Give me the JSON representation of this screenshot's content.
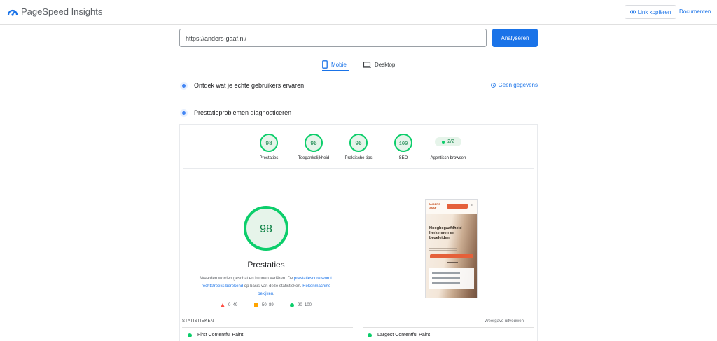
{
  "header": {
    "brand": "PageSpeed Insights",
    "copy_link_label": "Link kopiëren",
    "docs_label": "Documenten"
  },
  "url_bar": {
    "value": "https://anders-gaaf.nl/",
    "analyze_label": "Analyseren"
  },
  "tabs": [
    {
      "label": "Mobiel",
      "active": true
    },
    {
      "label": "Desktop",
      "active": false
    }
  ],
  "field_data": {
    "title": "Ontdek wat je echte gebruikers ervaren",
    "status": "Geen gegevens"
  },
  "lab_data": {
    "title": "Prestatieproblemen diagnosticeren"
  },
  "categories": [
    {
      "label": "Prestaties",
      "score": "98"
    },
    {
      "label": "Toegankelijkheid",
      "score": "96"
    },
    {
      "label": "Praktische tips",
      "score": "96"
    },
    {
      "label": "SEO",
      "score": "100"
    },
    {
      "label": "Agentisch browsen",
      "score": "2/2"
    }
  ],
  "performance": {
    "score": "98",
    "title": "Prestaties",
    "desc_1": "Waarden worden geschat en kunnen variëren. De ",
    "desc_link_1": "prestatiescore wordt rechtstreeks berekend",
    "desc_2": " op basis van deze statistieken. ",
    "desc_link_2": "Rekenmachine bekijken",
    "desc_3": ".",
    "legend": [
      {
        "range": "0–49",
        "color": "#ff4e42"
      },
      {
        "range": "50–89",
        "color": "#ffa400"
      },
      {
        "range": "90–100",
        "color": "#0cce6b"
      }
    ]
  },
  "screenshot": {
    "headline": "Hoogbegaafdheid herkennen en begeleiden"
  },
  "stats": {
    "heading": "STATISTIEKEN",
    "expand_label": "Weergave uitvouwen",
    "metrics": [
      {
        "label": "First Contentful Paint"
      },
      {
        "label": "Largest Contentful Paint"
      }
    ]
  },
  "colors": {
    "accent": "#1a73e8",
    "good": "#0cce6b",
    "good_bg": "#e6f4ea"
  }
}
